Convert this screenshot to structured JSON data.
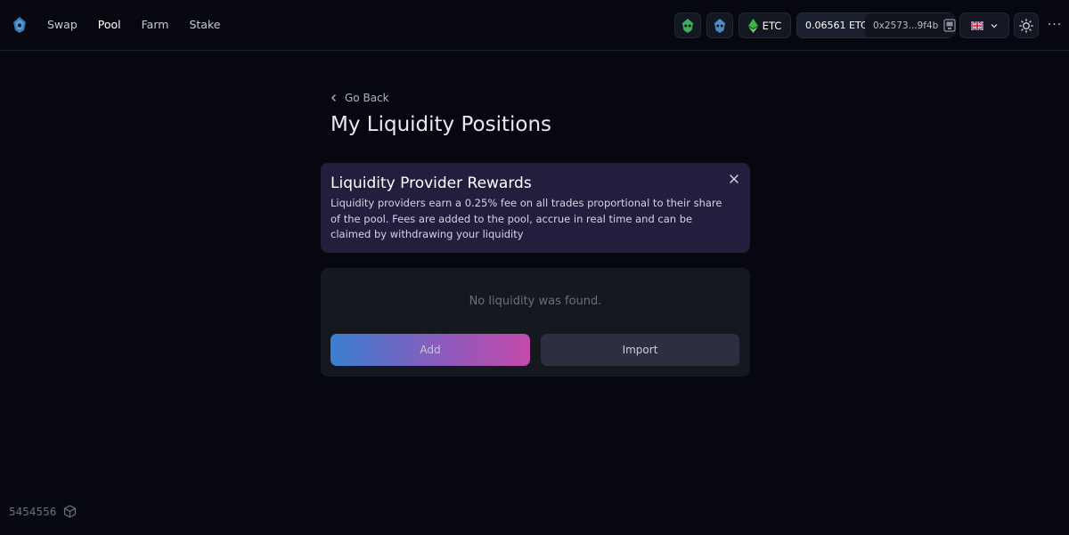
{
  "header": {
    "nav": [
      "Swap",
      "Pool",
      "Farm",
      "Stake"
    ],
    "active_nav": "Pool",
    "chain_label": "ETC",
    "balance": "0.06561 ETC",
    "address": "0x2573...9f4b",
    "more_label": "···"
  },
  "main": {
    "back_label": "Go Back",
    "title": "My Liquidity Positions",
    "rewards": {
      "title": "Liquidity Provider Rewards",
      "text": "Liquidity providers earn a 0.25% fee on all trades proportional to their share of the pool. Fees are added to the pool, accrue in real time and can be claimed by withdrawing your liquidity"
    },
    "positions": {
      "empty_message": "No liquidity was found.",
      "add_label": "Add",
      "import_label": "Import"
    }
  },
  "footer": {
    "block_number": "5454556"
  },
  "colors": {
    "background": "#07080f",
    "rewards_card": "#251d3e",
    "positions_card": "#161820",
    "etc_green": "#3ab83a"
  }
}
